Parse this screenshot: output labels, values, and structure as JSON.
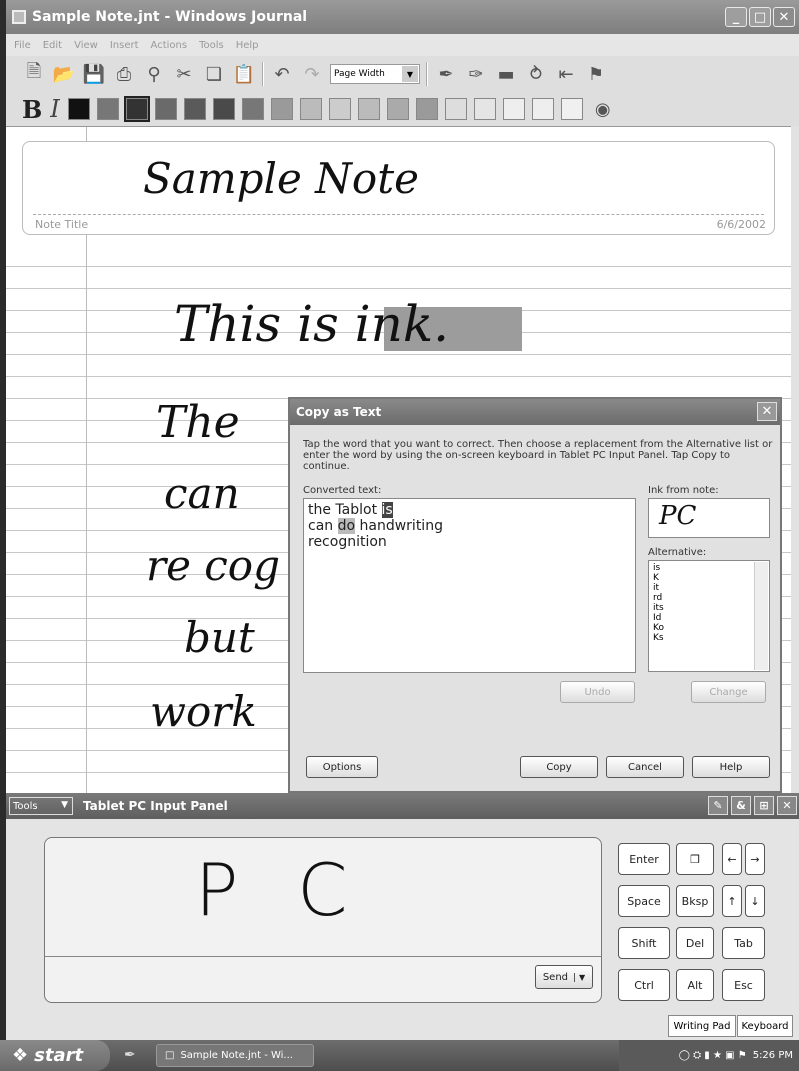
{
  "window": {
    "title": "Sample Note.jnt - Windows Journal",
    "controls": {
      "min": "_",
      "max": "□",
      "close": "✕"
    }
  },
  "menu": [
    "File",
    "Edit",
    "View",
    "Insert",
    "Actions",
    "Tools",
    "Help"
  ],
  "toolbar": {
    "zoom_value": "Page Width"
  },
  "formatbar": {
    "bold": "B",
    "italic": "I",
    "swatches": [
      "#111111",
      "#777777",
      "#333333",
      "#6a6a6a",
      "#5a5a5a",
      "#4a4a4a",
      "#777777",
      "#9a9a9a",
      "#bbbbbb",
      "#cccccc",
      "#bbbbbb",
      "#aaaaaa",
      "#9a9a9a",
      "#dddddd",
      "#e5e5e5",
      "#eeeeee",
      "#eeeeee",
      "#f0f0f0"
    ]
  },
  "note": {
    "handwritten_title": "Sample Note",
    "title_label": "Note Title",
    "date": "6/6/2002",
    "ink_line1": "This is ink.",
    "ink_words": [
      "The",
      "can",
      "re cog",
      "but",
      "work"
    ]
  },
  "dialog": {
    "title": "Copy as Text",
    "instructions": "Tap the word that you want to correct. Then choose a replacement from the Alternative list or enter the word by using the on-screen keyboard in Tablet PC Input Panel. Tap Copy to continue.",
    "converted_label": "Converted text:",
    "converted": {
      "line1_pre": "the Tablot ",
      "line1_sel": "is",
      "line2_pre": "can ",
      "line2_sel": "do",
      "line2_post": " handwriting",
      "line3": "recognition"
    },
    "ink_label": "Ink from note:",
    "ink_sample": "PC",
    "alt_label": "Alternative:",
    "alternatives": [
      "is",
      "K",
      "it",
      "rd",
      "its",
      "Id",
      "Ko",
      "Ks"
    ],
    "buttons": {
      "undo": "Undo",
      "change": "Change",
      "options": "Options",
      "copy": "Copy",
      "cancel": "Cancel",
      "help": "Help"
    }
  },
  "input_panel": {
    "tools": "Tools",
    "title": "Tablet PC Input Panel",
    "written": "P C",
    "send": "Send",
    "keys": {
      "enter": "Enter",
      "space": "Space",
      "bksp": "Bksp",
      "shift": "Shift",
      "del": "Del",
      "tab": "Tab",
      "ctrl": "Ctrl",
      "alt": "Alt",
      "esc": "Esc",
      "left": "←",
      "right": "→",
      "up": "↑",
      "down": "↓"
    },
    "tabs": {
      "writing_pad": "Writing Pad",
      "keyboard": "Keyboard"
    }
  },
  "taskbar": {
    "start": "start",
    "task": "Sample Note.jnt - Wi...",
    "clock": "5:26 PM"
  }
}
